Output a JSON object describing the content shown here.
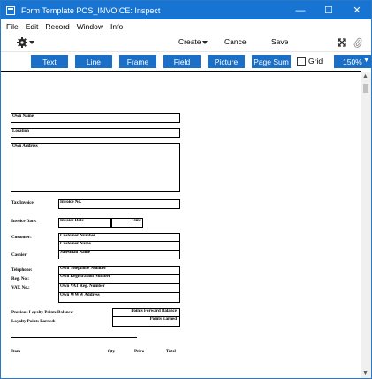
{
  "window": {
    "title": "Form Template POS_INVOICE: Inspect",
    "minimize_glyph": "—",
    "maximize_glyph": "☐",
    "close_glyph": "✕"
  },
  "menu": [
    "File",
    "Edit",
    "Record",
    "Window",
    "Info"
  ],
  "toolbar": {
    "create_label": "Create",
    "cancel_label": "Cancel",
    "save_label": "Save"
  },
  "insert_buttons": [
    "Text",
    "Line",
    "Frame",
    "Field",
    "Picture",
    "Page Sum"
  ],
  "grid_label": "Grid",
  "zoom": "150%",
  "form": {
    "own_name": "Own Name",
    "location": "Location",
    "own_address": "Own Address",
    "tax_invoice_label": "Tax Invoice:",
    "invoice_no": "Invoice No.",
    "invoice_date_label": "Invoice Date:",
    "invoice_date": "Invoice Date",
    "time": "Time",
    "customer_label": "Customer:",
    "customer_number": "Customer Number",
    "customer_name": "Customer Name",
    "cashier_label": "Cashier:",
    "salesman_name": "Salesman Name",
    "telephone_label": "Telephone:",
    "own_telephone": "Own Telephone Number",
    "reg_no_label": "Reg. No.:",
    "own_registration": "Own Registration Number",
    "vat_no_label": "VAT. No.:",
    "own_vat": "Own VAT Reg. Number",
    "own_www": "Own WWW Address",
    "prev_loyalty_label": "Previous Loyalty Points Balance:",
    "points_forward": "Points Forward Balance",
    "loyalty_earned_label": "Loyalty Points Earned:",
    "points_earned": "Points Earned",
    "col_item": "Item",
    "col_qty": "Qty",
    "col_price": "Price",
    "col_total": "Total"
  }
}
